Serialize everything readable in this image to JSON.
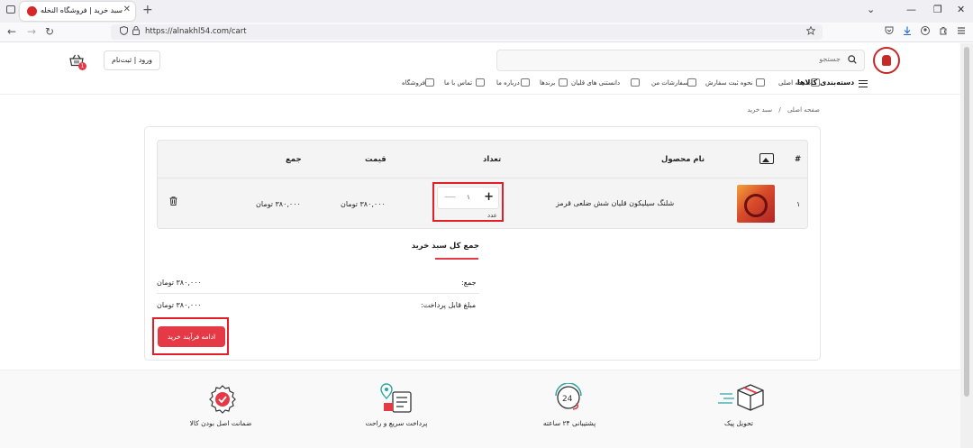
{
  "browser": {
    "tab_title": "سبد خرید | فروشگاه النخله | دانلود",
    "tab_close": "✕",
    "new_tab": "+",
    "url": "https://alnakhl54.com/cart",
    "nav": {
      "back": "←",
      "forward": "→",
      "reload": "↻"
    },
    "window": {
      "chevron": "⌄",
      "minimize": "—",
      "restore": "❐",
      "close": "✕"
    }
  },
  "header": {
    "search_placeholder": "جستجو",
    "login_label": "ورود | ثبت‌نام",
    "cart_count": "1"
  },
  "menu": {
    "categories": "دسته‌بندی کالاها",
    "items": [
      "صفحه اصلی",
      "نحوه ثبت سفارش",
      "سفارشات من",
      "دانستنی های قلیان",
      "برندها",
      "درباره ما",
      "تماس با ما",
      "فروشگاه"
    ]
  },
  "breadcrumb": {
    "home": "صفحه اصلی",
    "separator": "/",
    "current": "سبد خرید"
  },
  "cart": {
    "headers": {
      "index": "#",
      "name": "نام محصول",
      "qty": "تعداد",
      "price": "قیمت",
      "total": "جمع"
    },
    "items": [
      {
        "index": "۱",
        "name": "شلنگ سیلیکون قلیان شش ضلعی قرمز",
        "qty": "۱",
        "unit": "عدد",
        "price": "۳۸۰,۰۰۰ تومان",
        "total": "۳۸۰,۰۰۰ تومان"
      }
    ],
    "qty_plus": "+",
    "qty_minus": "—"
  },
  "summary": {
    "title": "جمع کل سبد خرید",
    "subtotal_label": "جمع:",
    "subtotal_value": "۳۸۰,۰۰۰ تومان",
    "payable_label": "مبلغ قابل پرداخت:",
    "payable_value": "۳۸۰,۰۰۰ تومان",
    "checkout_label": "ادامه فرآیند خرید"
  },
  "features": [
    "تحویل پیک",
    "پشتیبانی ۲۴ ساعته",
    "پرداخت سریع و راحت",
    "ضمانت اصل بودن کالا"
  ],
  "colors": {
    "accent": "#e53946",
    "highlight": "#e41e26"
  }
}
